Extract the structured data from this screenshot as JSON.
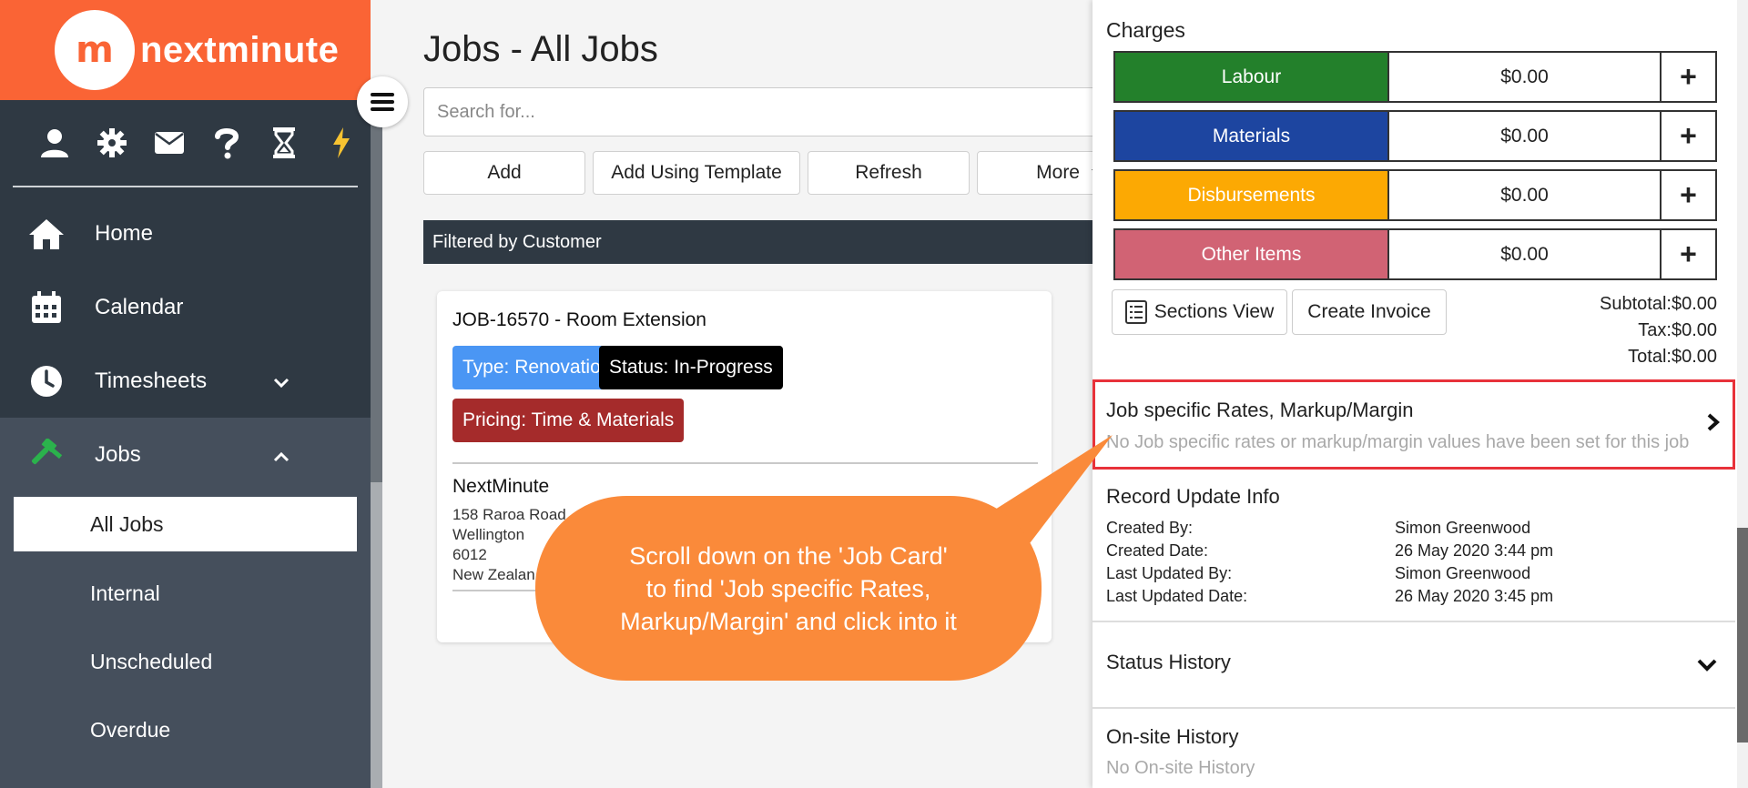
{
  "sidebar": {
    "logo_mark": "m",
    "brand": "nextminute",
    "nav": [
      {
        "label": "Home"
      },
      {
        "label": "Calendar"
      },
      {
        "label": "Timesheets"
      },
      {
        "label": "Jobs"
      }
    ],
    "jobs_sub": [
      {
        "label": "All Jobs"
      },
      {
        "label": "Internal"
      },
      {
        "label": "Unscheduled"
      },
      {
        "label": "Overdue"
      }
    ]
  },
  "main": {
    "title": "Jobs - All Jobs",
    "search_placeholder": "Search for...",
    "buttons": {
      "add": "Add",
      "template": "Add Using Template",
      "refresh": "Refresh",
      "more": "More"
    },
    "filter": "Filtered by Customer",
    "job": {
      "title": "JOB-16570 - Room Extension",
      "type": "Type: Renovation",
      "status": "Status: In-Progress",
      "pricing": "Pricing: Time & Materials",
      "customer": "NextMinute",
      "address": [
        "158 Raroa Road",
        "Wellington",
        "6012",
        "New Zealan"
      ]
    }
  },
  "callout": {
    "lines": [
      "Scroll down on the 'Job Card'",
      "to find 'Job specific Rates,",
      "Markup/Margin' and click into it"
    ]
  },
  "panel": {
    "charges_title": "Charges",
    "charges": [
      {
        "label": "Labour",
        "value": "$0.00",
        "color": "#23802b"
      },
      {
        "label": "Materials",
        "value": "$0.00",
        "color": "#1d45a0"
      },
      {
        "label": "Disbursements",
        "value": "$0.00",
        "color": "#fca903"
      },
      {
        "label": "Other Items",
        "value": "$0.00",
        "color": "#d16374"
      }
    ],
    "sections_view": "Sections View",
    "create_invoice": "Create Invoice",
    "subtotal": "Subtotal:$0.00",
    "tax": "Tax:$0.00",
    "total": "Total:$0.00",
    "rates_title": "Job specific Rates, Markup/Margin",
    "rates_desc": "No Job specific rates or markup/margin values have been set for this job",
    "record_title": "Record Update Info",
    "record": [
      {
        "label": "Created By:",
        "value": "Simon Greenwood"
      },
      {
        "label": "Created Date:",
        "value": "26 May 2020 3:44 pm"
      },
      {
        "label": "Last Updated By:",
        "value": "Simon Greenwood"
      },
      {
        "label": "Last Updated Date:",
        "value": "26 May 2020 3:45 pm"
      }
    ],
    "status_history": "Status History",
    "onsite_title": "On-site History",
    "onsite_desc": "No On-site History"
  },
  "colors": {
    "brand": "#fa6435",
    "callout": "#fa8a3a",
    "highlight": "#e8323a",
    "jobs_icon": "#2bb24c"
  }
}
